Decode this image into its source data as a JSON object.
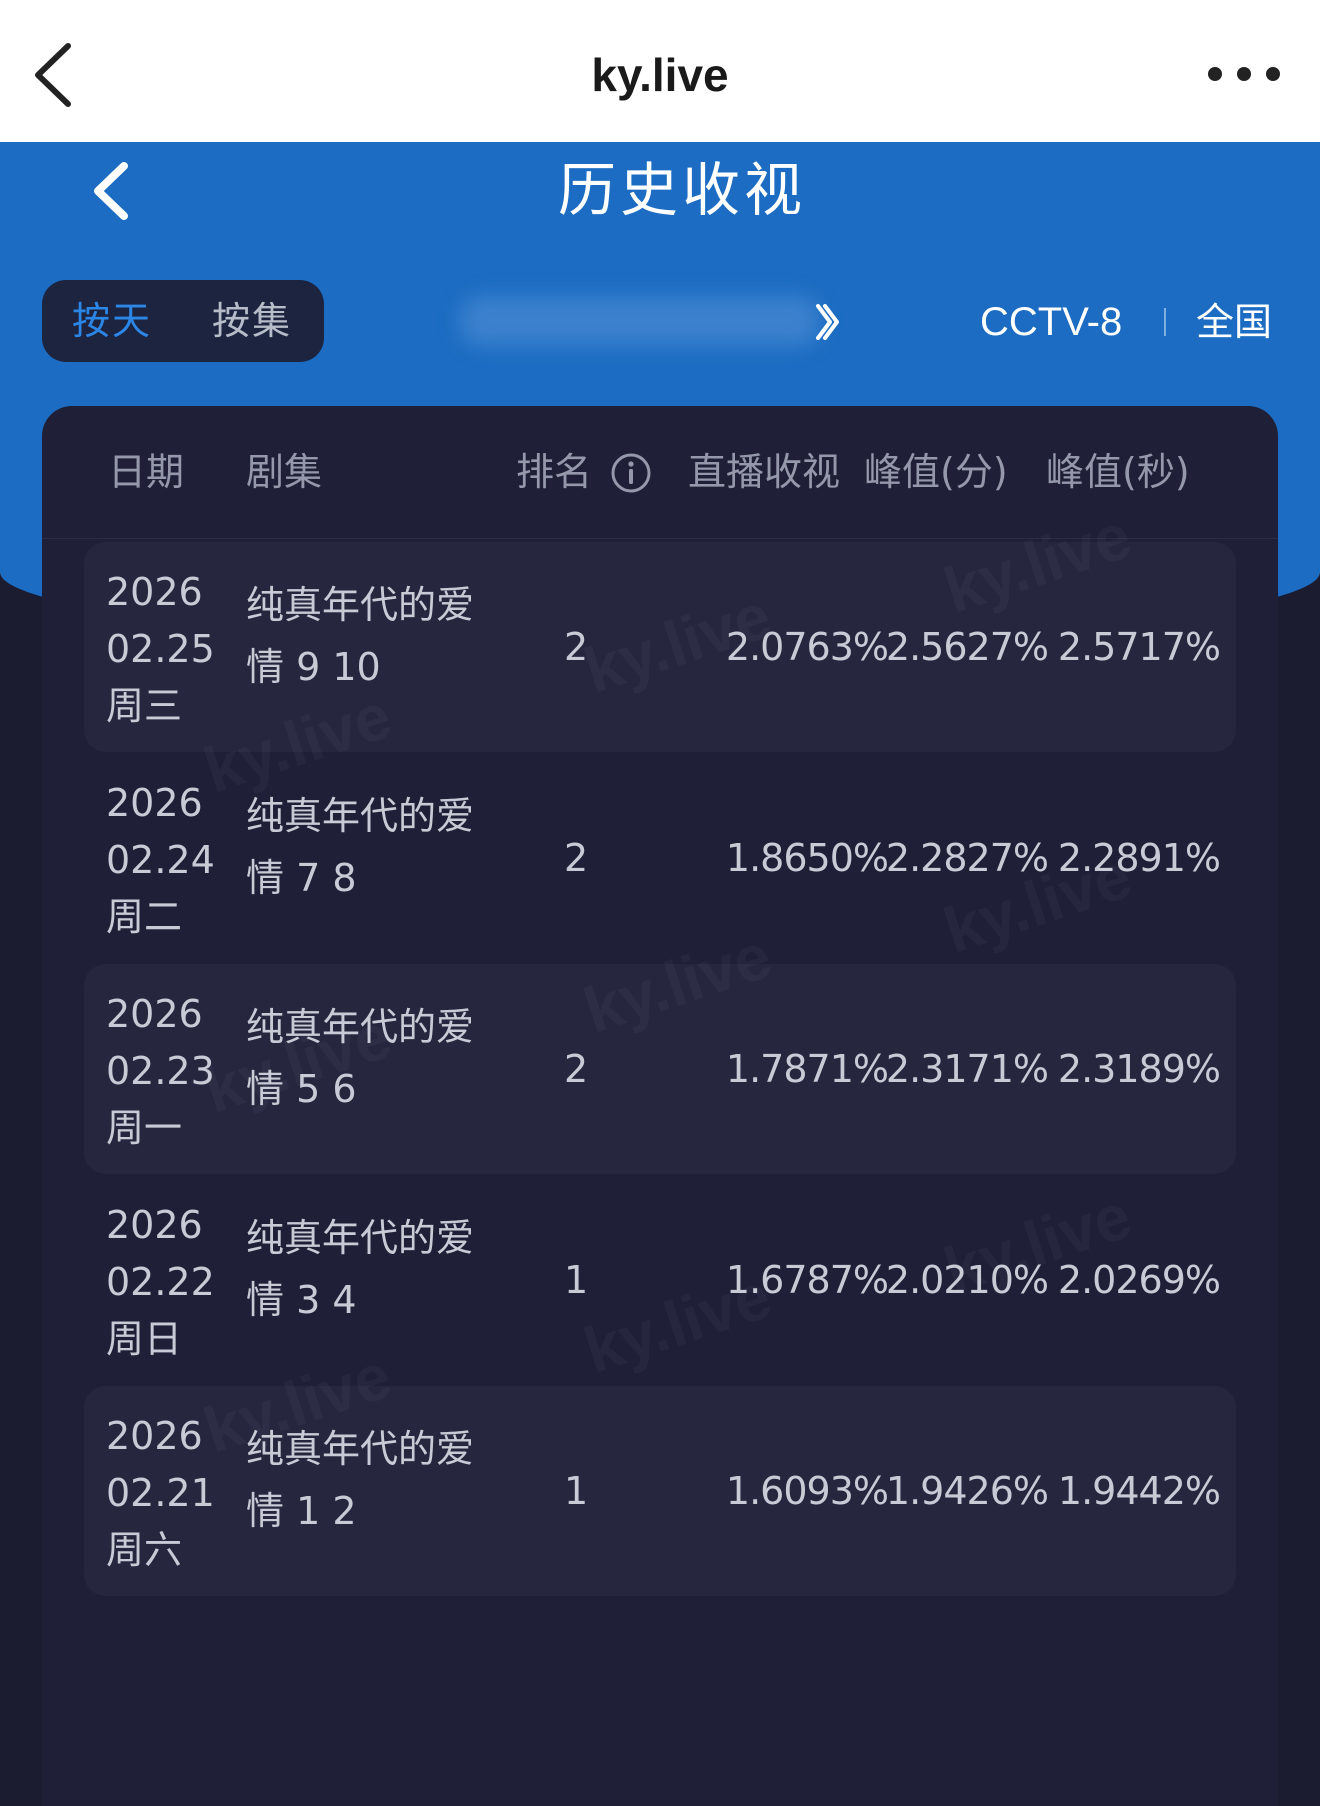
{
  "browser": {
    "title": "ky.live",
    "back_icon": "chevron-left-icon",
    "more_icon": "more-horizontal-icon"
  },
  "header": {
    "title": "历史收视",
    "back_icon": "chevron-left-icon"
  },
  "toggle": {
    "by_day": "按天",
    "by_episode": "按集",
    "active": "按天"
  },
  "filters": {
    "channel": "CCTV-8",
    "region": "全国"
  },
  "table": {
    "headers": [
      "日期",
      "剧集",
      "排名",
      "直播收视",
      "峰值(分)",
      "峰值(秒)"
    ],
    "rows": [
      {
        "year": "2026",
        "date": "02.25",
        "weekday": "周三",
        "title_line1": "纯真年代的爱",
        "title_line2": "情 9 10",
        "rank": "2",
        "live": "2.0763%",
        "peak_min": "2.5627%",
        "peak_sec": "2.5717%"
      },
      {
        "year": "2026",
        "date": "02.24",
        "weekday": "周二",
        "title_line1": "纯真年代的爱",
        "title_line2": "情 7 8",
        "rank": "2",
        "live": "1.8650%",
        "peak_min": "2.2827%",
        "peak_sec": "2.2891%"
      },
      {
        "year": "2026",
        "date": "02.23",
        "weekday": "周一",
        "title_line1": "纯真年代的爱",
        "title_line2": "情 5 6",
        "rank": "2",
        "live": "1.7871%",
        "peak_min": "2.3171%",
        "peak_sec": "2.3189%"
      },
      {
        "year": "2026",
        "date": "02.22",
        "weekday": "周日",
        "title_line1": "纯真年代的爱",
        "title_line2": "情 3 4",
        "rank": "1",
        "live": "1.6787%",
        "peak_min": "2.0210%",
        "peak_sec": "2.0269%"
      },
      {
        "year": "2026",
        "date": "02.21",
        "weekday": "周六",
        "title_line1": "纯真年代的爱",
        "title_line2": "情 1 2",
        "rank": "1",
        "live": "1.6093%",
        "peak_min": "1.9426%",
        "peak_sec": "1.9442%"
      }
    ]
  },
  "watermark": "ky.live",
  "colors": {
    "header_blue": "#1b6cc2",
    "active_tab": "#2c86e6",
    "card_bg": "#1f2037",
    "row_alt_bg": "#26273f"
  }
}
